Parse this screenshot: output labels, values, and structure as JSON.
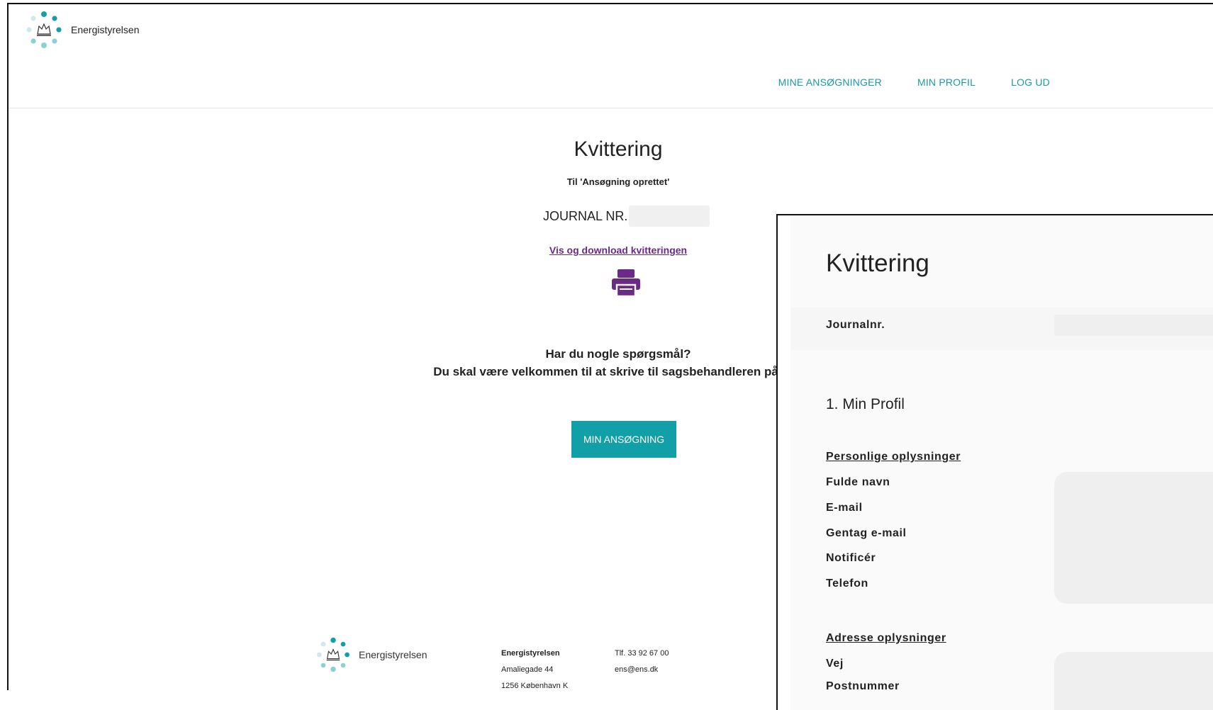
{
  "header": {
    "logo_text": "Energistyrelsen",
    "nav": [
      "MINE ANSØGNINGER",
      "MIN PROFIL",
      "LOG UD"
    ]
  },
  "main": {
    "title": "Kvittering",
    "subtitle": "Til 'Ansøgning oprettet'",
    "journal_label": "JOURNAL NR.",
    "download_link": "Vis og download kvitteringen",
    "question_line1": "Har du nogle spørgsmål?",
    "question_line2": "Du skal være velkommen til at skrive til sagsbehandleren på den",
    "button_label": "MIN ANSØGNING"
  },
  "footer": {
    "logo_text": "Energistyrelsen",
    "org": "Energistyrelsen",
    "street": "Amaliegade 44",
    "city": "1256 København K",
    "phone": "Tlf. 33 92 67 00",
    "email": "ens@ens.dk"
  },
  "receipt": {
    "title": "Kvittering",
    "journal_label": "Journalnr.",
    "section1": "1. Min Profil",
    "personal_heading": "Personlige oplysninger",
    "fields": [
      "Fulde navn",
      "E-mail",
      "Gentag e-mail",
      "Notificér",
      "Telefon"
    ],
    "address_heading": "Adresse oplysninger",
    "address_fields": [
      "Vej",
      "Postnummer"
    ]
  },
  "colors": {
    "accent": "#12a0a8",
    "nav_link": "#1a9aa5",
    "link_purple": "#6b2a87"
  }
}
